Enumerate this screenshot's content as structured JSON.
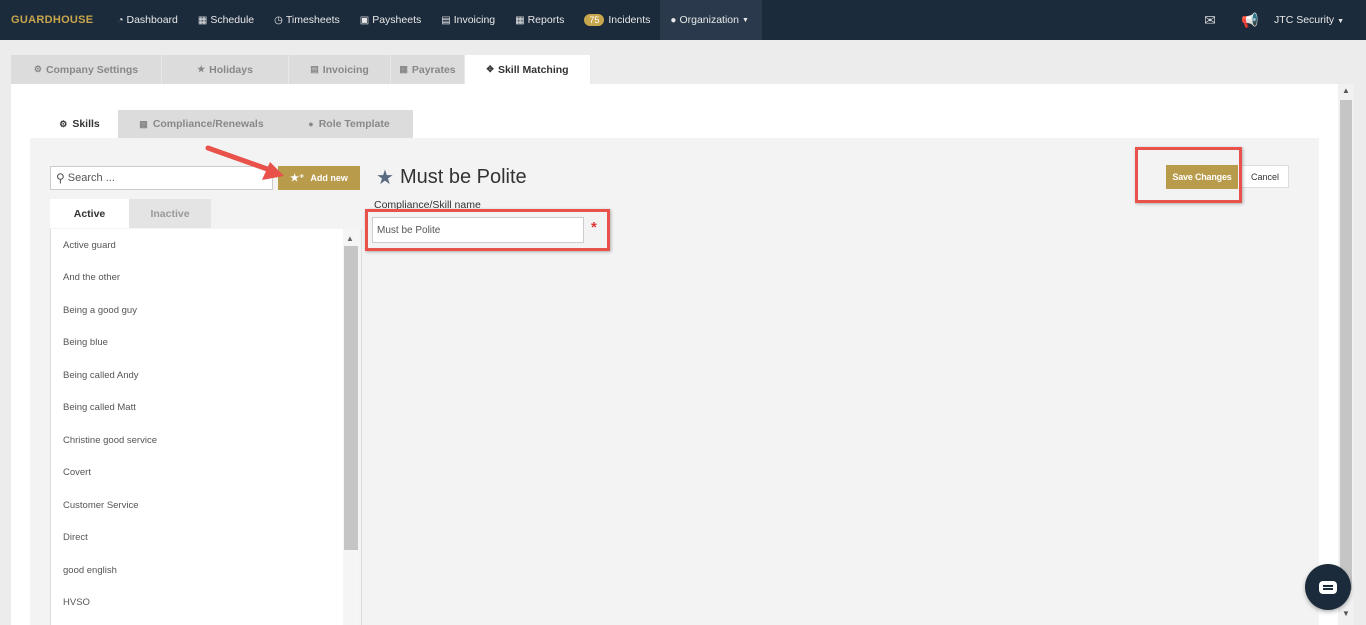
{
  "brand": "GUARDHOUSE",
  "nav": [
    {
      "label": "Dashboard",
      "icon": "dashboard-icon",
      "glyph": "⚙"
    },
    {
      "label": "Schedule",
      "icon": "calendar-icon",
      "glyph": "▦"
    },
    {
      "label": "Timesheets",
      "icon": "clock-icon",
      "glyph": "◷"
    },
    {
      "label": "Paysheets",
      "icon": "money-icon",
      "glyph": "▣"
    },
    {
      "label": "Invoicing",
      "icon": "list-icon",
      "glyph": "▤"
    },
    {
      "label": "Reports",
      "icon": "table-icon",
      "glyph": "▦"
    },
    {
      "label": "Incidents",
      "icon": "badge",
      "badge": "75"
    },
    {
      "label": "Organization",
      "icon": "users-icon",
      "glyph": "👥"
    }
  ],
  "user": "JTC Security",
  "settings_tabs": {
    "company": "Company Settings",
    "holidays": "Holidays",
    "invoicing": "Invoicing",
    "payrates": "Payrates",
    "skill_matching": "Skill Matching"
  },
  "sub_tabs": {
    "skills": "Skills",
    "compliance": "Compliance/Renewals",
    "role_template": "Role Template"
  },
  "search": {
    "placeholder": "Search ..."
  },
  "add_new": "Add new",
  "filter_tabs": {
    "active": "Active",
    "inactive": "Inactive"
  },
  "skills_list": [
    "Active guard",
    "And the other",
    "Being a good guy",
    "Being blue",
    "Being called Andy",
    "Being called Matt",
    "Christine good service",
    "Covert",
    "Customer Service",
    "Direct",
    "good english",
    "HVSO"
  ],
  "editor": {
    "title": "Must be Polite",
    "field_label": "Compliance/Skill name",
    "field_value": "Must be Polite",
    "required_mark": "*",
    "save_label": "Save Changes",
    "cancel_label": "Cancel"
  },
  "colors": {
    "navbar": "#1c2b3c",
    "accent_gold": "#b89b4b",
    "highlight_red": "#e8524a"
  }
}
